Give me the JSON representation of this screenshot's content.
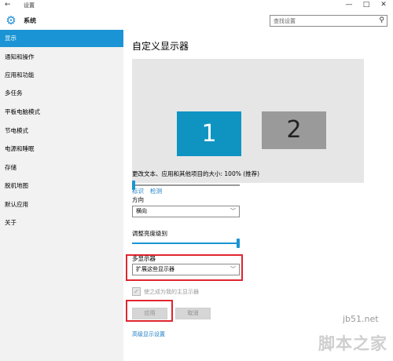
{
  "window": {
    "title": "设置",
    "back_glyph": "←",
    "minimize_glyph": "—",
    "maximize_glyph": "□",
    "close_glyph": "✕"
  },
  "header": {
    "app_title": "系统",
    "search_placeholder": "查找设置"
  },
  "sidebar": {
    "items": [
      {
        "label": "显示",
        "active": true
      },
      {
        "label": "通知和操作"
      },
      {
        "label": "应用和功能"
      },
      {
        "label": "多任务"
      },
      {
        "label": "平板电脑模式"
      },
      {
        "label": "节电模式"
      },
      {
        "label": "电源和睡眠"
      },
      {
        "label": "存储"
      },
      {
        "label": "脱机地图"
      },
      {
        "label": "默认应用"
      },
      {
        "label": "关于"
      }
    ]
  },
  "main": {
    "title": "自定义显示器",
    "monitors": [
      "1",
      "2"
    ],
    "identify_link": "标识",
    "detect_link": "检测",
    "scale_label": "更改文本、应用和其他项目的大小: 100% (推荐)",
    "scale_level": 0,
    "orientation_label": "方向",
    "orientation_value": "横向",
    "brightness_label": "调整亮度级别",
    "brightness_level": 1.0,
    "multi_display_label": "多显示器",
    "multi_display_value": "扩展这些显示器",
    "main_display_checkbox": "使之成为我的主显示器",
    "main_display_checked": true,
    "apply_button": "应用",
    "cancel_button": "取消",
    "advanced_link": "高级显示设置"
  },
  "watermark": {
    "site": "jb51.net",
    "text": "脚本之家"
  },
  "colors": {
    "accent": "#1a94d4",
    "monitor_1": "#0f94c2",
    "monitor_2": "#9a9a9a",
    "highlight": "#e0262e"
  }
}
